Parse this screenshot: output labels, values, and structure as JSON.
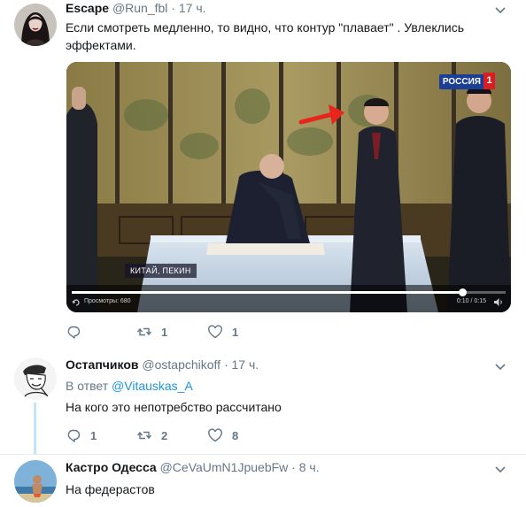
{
  "tweets": [
    {
      "name": "Escape",
      "handle": "@Run_fbl",
      "dot": "·",
      "time": "17 ч.",
      "text": "Если смотреть медленно, то видно, что контур \"плавает\" . Увлеклись эффектами.",
      "media": {
        "caption": "КИТАЙ, ПЕКИН",
        "channel_logo": "РОССИЯ",
        "channel_number": "1",
        "views_label": "Просмотры: 680",
        "video_time": "0:10 / 0:15",
        "progress": 0.9
      },
      "actions": {
        "reply_count": "",
        "retweet_count": "1",
        "like_count": "1"
      }
    },
    {
      "name": "Остапчиков",
      "handle": "@ostapchikoff",
      "dot": "·",
      "time": "17 ч.",
      "reply_prefix": "В ответ",
      "reply_mention": "@Vitauskas_A",
      "text": "На кого это непотребство рассчитано",
      "actions": {
        "reply_count": "1",
        "retweet_count": "2",
        "like_count": "8"
      }
    },
    {
      "name": "Кастро Одесса",
      "handle": "@CeVaUmN1JpuebFw",
      "dot": "·",
      "time": "8 ч.",
      "text": "На федерастов"
    }
  ],
  "colors": {
    "link": "#1b95e0",
    "muted": "#657786",
    "thread_line": "#c4e4f7",
    "arrow": "#e8251b"
  },
  "icons": [
    "reply-icon",
    "retweet-icon",
    "like-icon",
    "caret-down-icon",
    "loop-icon",
    "sound-icon"
  ]
}
